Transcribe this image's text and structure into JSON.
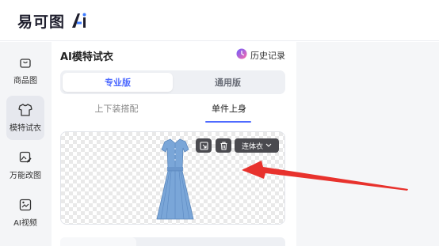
{
  "brand": {
    "name": "易可图",
    "ai_mark": "Ai"
  },
  "nav": {
    "items": [
      {
        "label": "商品图",
        "icon": "bag-icon"
      },
      {
        "label": "模特试衣",
        "icon": "tshirt-icon",
        "active": true
      },
      {
        "label": "万能改图",
        "icon": "image-edit-icon"
      },
      {
        "label": "AI视频",
        "icon": "video-icon"
      }
    ]
  },
  "panel": {
    "title": "AI模特试衣",
    "history_label": "历史记录",
    "mode_tabs": [
      {
        "label": "专业版",
        "active": true
      },
      {
        "label": "通用版",
        "active": false
      }
    ],
    "sub_tabs": [
      {
        "label": "上下装搭配",
        "active": false
      },
      {
        "label": "单件上身",
        "active": true
      }
    ],
    "canvas": {
      "garment_type": "连体衣",
      "tool_icons": [
        "crop-icon",
        "trash-icon"
      ]
    }
  },
  "colors": {
    "accent": "#4f6bff",
    "arrow": "#e8322d",
    "dress": "#7aa6d8"
  }
}
